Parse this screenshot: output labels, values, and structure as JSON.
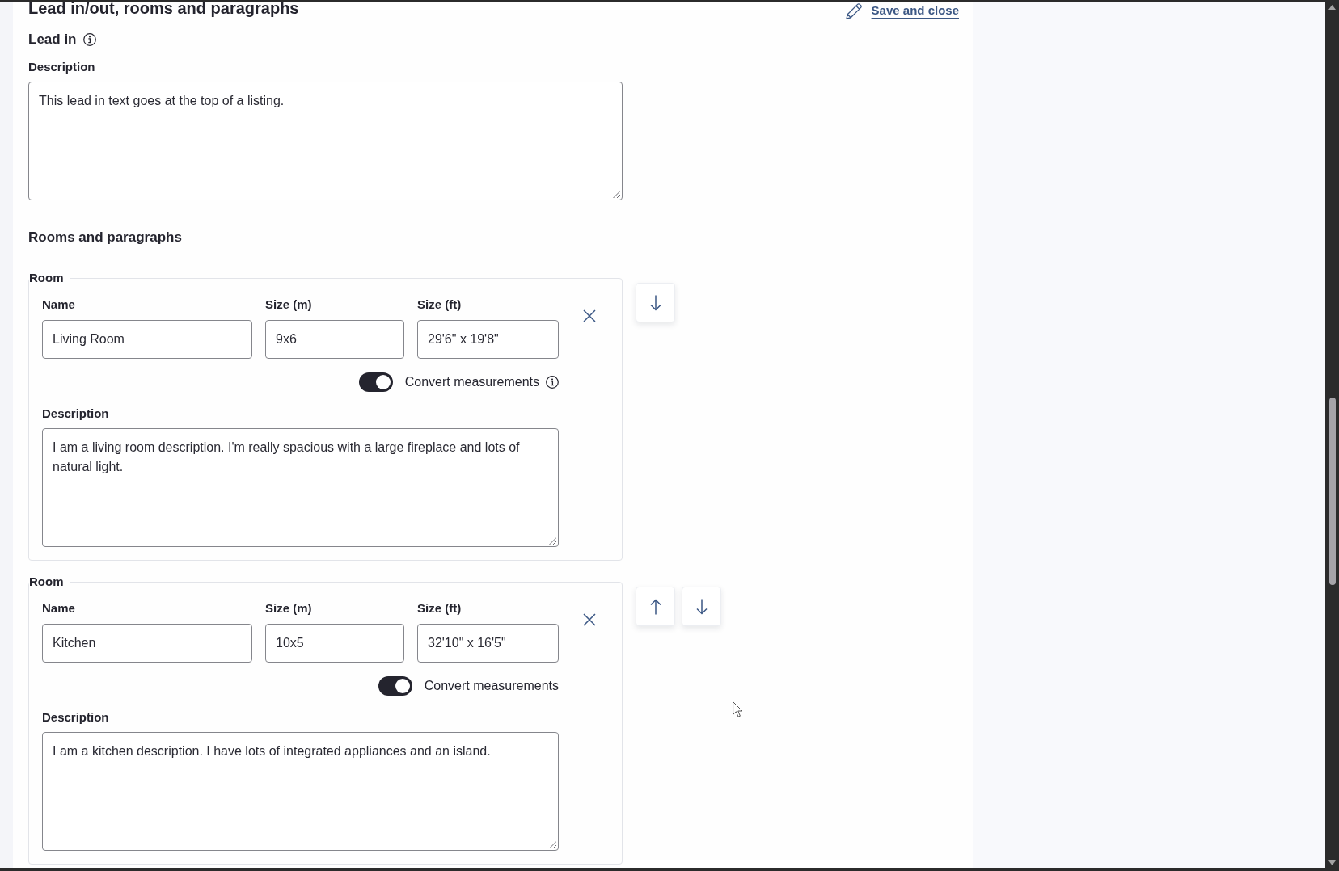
{
  "header": {
    "title": "Lead in/out, rooms and paragraphs",
    "save_link": "Save and close"
  },
  "lead_in": {
    "heading": "Lead in",
    "info_icon": true,
    "description_label": "Description",
    "description": "This lead in text goes at the top of a listing."
  },
  "rooms_section": {
    "heading": "Rooms and paragraphs",
    "rooms": [
      {
        "legend": "Room",
        "fields": [
          {
            "label": "Name",
            "value": "Living Room"
          },
          {
            "label": "Size (m)",
            "value": "9x6"
          },
          {
            "label": "Size (ft)",
            "value": "29'6\" x 19'8\""
          }
        ],
        "convert": {
          "label": "Convert measurements",
          "on": true,
          "info_icon": true
        },
        "description_label": "Description",
        "description": "I am a living room description. I'm really spacious with a large fireplace and lots of natural light.",
        "move_up": false,
        "move_down": true
      },
      {
        "legend": "Room",
        "fields": [
          {
            "label": "Name",
            "value": "Kitchen"
          },
          {
            "label": "Size (m)",
            "value": "10x5"
          },
          {
            "label": "Size (ft)",
            "value": "32'10\" x 16'5\""
          }
        ],
        "convert": {
          "label": "Convert measurements",
          "on": true,
          "info_icon": false
        },
        "description_label": "Description",
        "description": "I am a kitchen description. I have lots of integrated appliances and an island.",
        "move_up": true,
        "move_down": true
      }
    ]
  }
}
